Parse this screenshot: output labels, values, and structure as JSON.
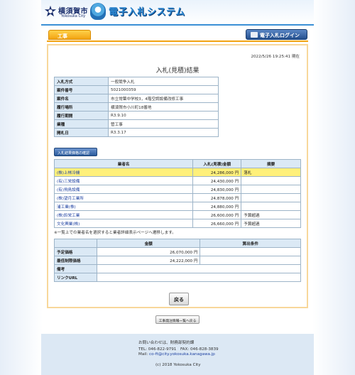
{
  "header": {
    "city_name": "横須賀市",
    "city_sub": "Yokosuka City",
    "system_title": "電子入札システム"
  },
  "nav": {
    "tab_label": "工事",
    "login_label": "電子入札ログイン"
  },
  "timestamp": "2022/5/26 19:25:41 現在",
  "page_title": "入札(見積)結果",
  "info": [
    {
      "key": "入札方式",
      "value": "一般競争入札"
    },
    {
      "key": "案件番号",
      "value": "5021000359"
    },
    {
      "key": "案件名",
      "value": "市立常葉中学校3，4階空調設備改修工事"
    },
    {
      "key": "履行場所",
      "value": "横須賀市小川町18番地"
    },
    {
      "key": "履行期間",
      "value": "R3.9.10"
    },
    {
      "key": "業種",
      "value": "管工事"
    },
    {
      "key": "開札日",
      "value": "R3.3.17"
    }
  ],
  "confirm_button": "入札結果価格の確認",
  "results": {
    "headers": [
      "業者名",
      "入札(見積)金額",
      "摘要"
    ],
    "rows": [
      {
        "name": "(株)上林冷機",
        "amount": "24,286,000 円",
        "note": "落札"
      },
      {
        "name": "(有)三栄設備",
        "amount": "24,430,000 円",
        "note": ""
      },
      {
        "name": "(有)飛鳥設備",
        "amount": "24,830,000 円",
        "note": ""
      },
      {
        "name": "(株)望月工業所",
        "amount": "24,878,000 円",
        "note": ""
      },
      {
        "name": "浦工業(株)",
        "amount": "24,880,000 円",
        "note": ""
      },
      {
        "name": "(株)鈴栄工業",
        "amount": "26,600,000 円",
        "note": "予算超過"
      },
      {
        "name": "文化興業(株)",
        "amount": "26,660,000 円",
        "note": "予算超過"
      }
    ]
  },
  "note_text": "※一覧上での業者名を選択すると業者詳細表示ページへ遷移します。",
  "price": {
    "headers": [
      "",
      "金額",
      "算出条件"
    ],
    "rows": [
      {
        "key": "予定価格",
        "amount": "26,070,000 円",
        "cond": ""
      },
      {
        "key": "最低制限価格",
        "amount": "24,222,000 円",
        "cond": ""
      },
      {
        "key": "備考",
        "amount": "",
        "cond": ""
      },
      {
        "key": "リンクURL",
        "amount": "",
        "cond": ""
      }
    ]
  },
  "back_button": "戻る",
  "list_button": "工事発注情報一覧へ戻る",
  "footer": {
    "contact": "お問い合わせは、財務部契約課",
    "tel": "TEL: 046-822-9791　FAX: 046-828-3839",
    "mail_label": "Mail: ",
    "mail": "co-ft@city.yokosuka.kanagawa.jp",
    "copyright": "(c) 2018 Yokosuka City"
  },
  "colors": {
    "accent": "#3a8fd6",
    "tab": "#f2a312",
    "winner_row": "#fff07a",
    "header_cell": "#dbe9f5"
  }
}
